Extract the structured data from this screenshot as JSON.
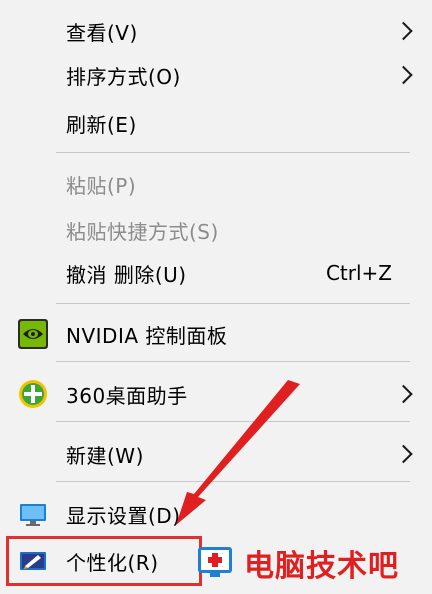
{
  "menu": {
    "items": [
      {
        "label": "查看(V)",
        "submenu": true
      },
      {
        "label": "排序方式(O)",
        "submenu": true
      },
      {
        "label": "刷新(E)"
      },
      {
        "label": "粘贴(P)",
        "disabled": true
      },
      {
        "label": "粘贴快捷方式(S)",
        "disabled": true
      },
      {
        "label": "撤消 删除(U)",
        "shortcut": "Ctrl+Z"
      },
      {
        "label": "NVIDIA 控制面板",
        "icon": "nvidia-icon"
      },
      {
        "label": "360桌面助手",
        "icon": "360-assistant-icon",
        "submenu": true
      },
      {
        "label": "新建(W)",
        "submenu": true
      },
      {
        "label": "显示设置(D)",
        "icon": "display-settings-icon"
      },
      {
        "label": "个性化(R)",
        "icon": "personalization-icon"
      }
    ]
  },
  "annotation": {
    "highlight_color": "#e03030",
    "arrow_color": "#e02020"
  },
  "watermark": {
    "text": "电脑技术吧",
    "color": "#e02020"
  }
}
